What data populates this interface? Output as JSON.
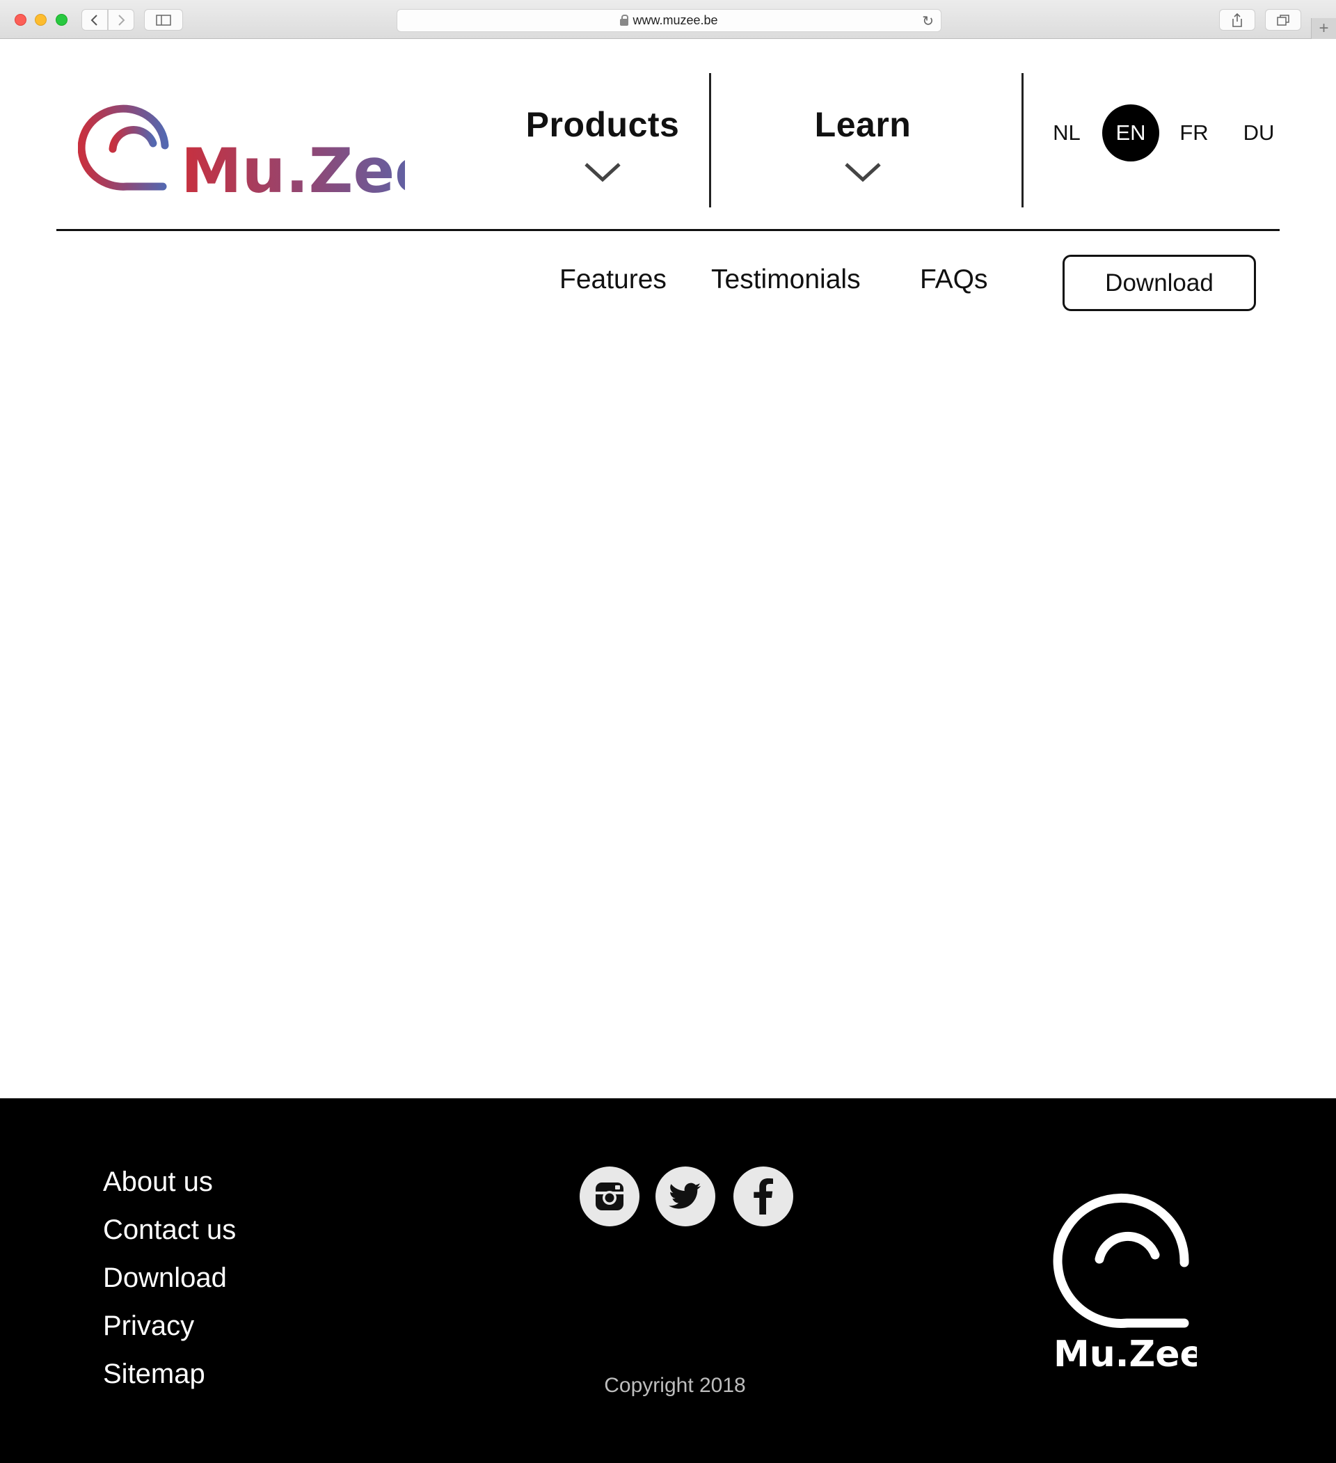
{
  "browser": {
    "url": "www.muzee.be"
  },
  "header": {
    "brand": "Mu.Zee",
    "nav": [
      {
        "label": "Products"
      },
      {
        "label": "Learn"
      }
    ],
    "languages": [
      {
        "code": "NL",
        "active": false
      },
      {
        "code": "EN",
        "active": true
      },
      {
        "code": "FR",
        "active": false
      },
      {
        "code": "DU",
        "active": false
      }
    ]
  },
  "subnav": {
    "features": "Features",
    "testimonials": "Testimonials",
    "faqs": "FAQs",
    "download": "Download"
  },
  "footer": {
    "links": [
      "About us",
      "Contact us",
      "Download",
      "Privacy",
      "Sitemap"
    ],
    "social": [
      "instagram-icon",
      "twitter-icon",
      "facebook-icon"
    ],
    "copyright": "Copyright 2018",
    "brand": "Mu.Zee"
  },
  "colors": {
    "logo_gradient_start": "#c8303e",
    "logo_gradient_end": "#5468b0",
    "footer_bg": "#000000",
    "active_lang_bg": "#000000"
  }
}
